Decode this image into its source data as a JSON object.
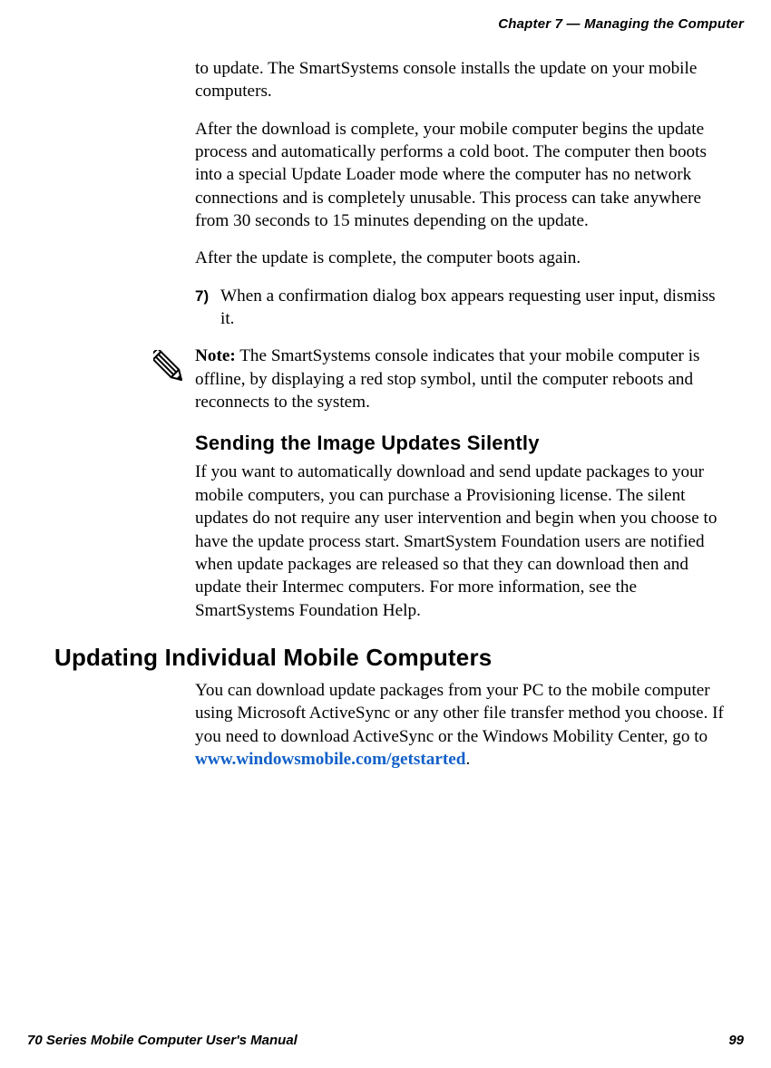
{
  "header": {
    "chapter": "Chapter 7 — Managing the Computer"
  },
  "continuation": {
    "p1": "to update. The SmartSystems console installs the update on your mobile computers.",
    "p2": "After the download is complete, your mobile computer begins the update process and automatically performs a cold boot. The computer then boots into a special Update Loader mode where the computer has no network connections and is completely unusable. This process can take anywhere from 30 seconds to 15 minutes depending on the update.",
    "p3": "After the update is complete, the computer boots again."
  },
  "step7": {
    "num": "7)",
    "text": "When a confirmation dialog box appears requesting user input, dismiss it."
  },
  "note": {
    "label": "Note:",
    "text": "  The SmartSystems console indicates that your mobile computer is offline, by displaying a red stop symbol, until the computer reboots and reconnects to the system."
  },
  "silent": {
    "heading": "Sending the Image Updates Silently",
    "body": "If you want to automatically download and send update packages to your mobile computers, you can purchase a Provisioning license. The silent updates do not require any user intervention and begin when you choose to have the update process start. SmartSystem Foundation users are notified when update packages are released so that they can download then and update their Intermec computers. For more information, see the SmartSystems Foundation Help."
  },
  "updating": {
    "heading": "Updating Individual Mobile Computers",
    "body_before_link": "You can download update packages from your PC to the mobile computer using Microsoft ActiveSync or any other file transfer method you choose. If you need to download ActiveSync or the Windows Mobility Center, go to ",
    "link_text": "www.windowsmobile.com/getstarted",
    "body_after_link": "."
  },
  "footer": {
    "left": "70 Series Mobile Computer User's Manual",
    "right": "99"
  }
}
